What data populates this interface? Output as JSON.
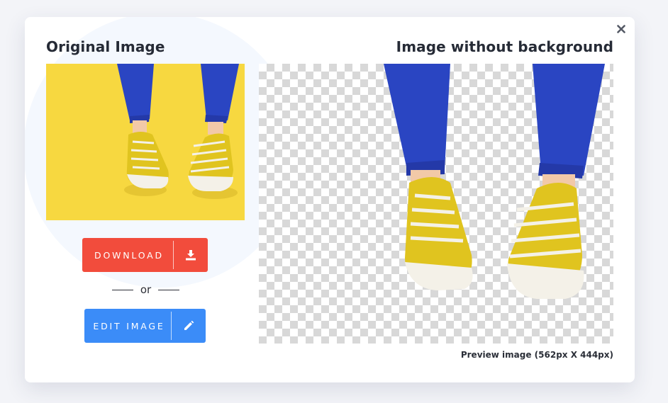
{
  "dialog": {
    "left_title": "Original Image",
    "right_title": "Image without background",
    "close_icon": "close-icon",
    "download_label": "DOWNLOAD",
    "download_icon": "download-icon",
    "or_label": "or",
    "edit_label": "EDIT IMAGE",
    "edit_icon": "pencil-icon",
    "preview_caption": "Preview image (562px X 444px)"
  },
  "colors": {
    "download_button": "#f24c3c",
    "edit_button": "#3b8cf8",
    "original_background": "#f7d840",
    "shoe": "#e0c41f",
    "pants": "#2a45c2"
  }
}
